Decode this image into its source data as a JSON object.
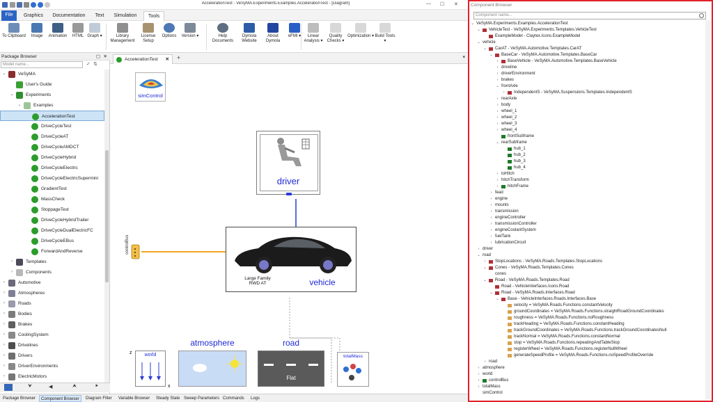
{
  "window": {
    "title": "AccelerationTest - VeSyMA.Experiments.Examples.AccelerationTest - [Diagram]"
  },
  "menu": {
    "tabs": [
      "File",
      "Graphics",
      "Documentation",
      "Text",
      "Simulation",
      "Tools"
    ],
    "active_tab": "Tools"
  },
  "ribbon": {
    "buttons": [
      "To Clipboard",
      "Image",
      "Animation",
      "HTML",
      "Graph ▾",
      "Library Management",
      "License Setup",
      "Options",
      "Version ▾",
      "Help Documents",
      "Dymola Website",
      "About Dymola",
      "eFMI ▾",
      "Linear Analysis ▾",
      "Quality Checks ▾",
      "Optimization ▾",
      "Build Tools ▾"
    ]
  },
  "package_browser": {
    "title": "Package Browser",
    "filter_placeholder": "Model name...",
    "items": [
      {
        "label": "VeSyMA",
        "indent": 0,
        "expand": "⌄",
        "icon": "#8b2d2d"
      },
      {
        "label": "User's Guide",
        "indent": 1,
        "expand": "",
        "icon": "#39a035"
      },
      {
        "label": "Experiments",
        "indent": 1,
        "expand": "⌄",
        "icon": "#2f8f2f"
      },
      {
        "label": "Examples",
        "indent": 2,
        "expand": "⌄",
        "icon": "#9cc69a"
      },
      {
        "label": "AccelerationTest",
        "indent": 3,
        "expand": "",
        "icon": "#2c9c2c",
        "selected": true
      },
      {
        "label": "DriveCycleTest",
        "indent": 3,
        "expand": "",
        "icon": "#2c9c2c"
      },
      {
        "label": "DriveCycleAT",
        "indent": 3,
        "expand": "",
        "icon": "#2c9c2c"
      },
      {
        "label": "DriveCycleAMDCT",
        "indent": 3,
        "expand": "",
        "icon": "#2c9c2c"
      },
      {
        "label": "DriveCycleHybrid",
        "indent": 3,
        "expand": "",
        "icon": "#2c9c2c"
      },
      {
        "label": "DriveCycleElectric",
        "indent": 3,
        "expand": "",
        "icon": "#2c9c2c"
      },
      {
        "label": "DriveCycleElectricSupermini",
        "indent": 3,
        "expand": "",
        "icon": "#2c9c2c"
      },
      {
        "label": "GradientTest",
        "indent": 3,
        "expand": "",
        "icon": "#2c9c2c"
      },
      {
        "label": "MassCheck",
        "indent": 3,
        "expand": "",
        "icon": "#2c9c2c"
      },
      {
        "label": "StoppageTest",
        "indent": 3,
        "expand": "",
        "icon": "#2c9c2c"
      },
      {
        "label": "DriveCycleHybridTrailer",
        "indent": 3,
        "expand": "",
        "icon": "#2c9c2c"
      },
      {
        "label": "DriveCycleDualElectricFC",
        "indent": 3,
        "expand": "",
        "icon": "#2c9c2c"
      },
      {
        "label": "DriveCycleEBus",
        "indent": 3,
        "expand": "",
        "icon": "#2c9c2c"
      },
      {
        "label": "ForwardAndReverse",
        "indent": 3,
        "expand": "",
        "icon": "#2c9c2c"
      },
      {
        "label": "Templates",
        "indent": 1,
        "expand": "›",
        "icon": "#4b4b5a"
      },
      {
        "label": "Components",
        "indent": 1,
        "expand": "›",
        "icon": "#b8b8b8"
      },
      {
        "label": "Automotive",
        "indent": 0,
        "expand": "›",
        "icon": "#6a6a7a"
      },
      {
        "label": "Atmospheres",
        "indent": 0,
        "expand": "›",
        "icon": "#7f7f95"
      },
      {
        "label": "Roads",
        "indent": 0,
        "expand": "›",
        "icon": "#9a9aae"
      },
      {
        "label": "Bodies",
        "indent": 0,
        "expand": "›",
        "icon": "#7b7b7b"
      },
      {
        "label": "Brakes",
        "indent": 0,
        "expand": "›",
        "icon": "#5f5f5f"
      },
      {
        "label": "CoolingSystem",
        "indent": 0,
        "expand": "›",
        "icon": "#8a8a8a"
      },
      {
        "label": "Drivelines",
        "indent": 0,
        "expand": "›",
        "icon": "#4f4f4f"
      },
      {
        "label": "Drivers",
        "indent": 0,
        "expand": "›",
        "icon": "#6f6f6f"
      },
      {
        "label": "DriverEnvironments",
        "indent": 0,
        "expand": "›",
        "icon": "#888"
      },
      {
        "label": "ElectricMotors",
        "indent": 0,
        "expand": "›",
        "icon": "#777"
      }
    ]
  },
  "diagram": {
    "tab_label": "AccelerationTest",
    "blocks": {
      "simControl": "simControl",
      "driver": "driver",
      "vehicle": "vehicle",
      "vehicle_sub": "Large Family\nRWD AT",
      "controlBus": "controlBus",
      "world": "world",
      "atmosphere": "atmosphere",
      "road": "road",
      "road_sub": "Flat",
      "totalMass": "totalMass"
    }
  },
  "bottom_tabs": {
    "tabs": [
      "Package Browser",
      "Component Browser",
      "Diagram Filter",
      "Variable Browser",
      "Steady State",
      "Sweep Parameters",
      "Commands",
      "Logs"
    ],
    "active": "Component Browser"
  },
  "component_browser": {
    "title": "Component Browser",
    "filter_placeholder": "Component name...",
    "rows": [
      {
        "t": "VeSyMA.Experiments.Examples.AccelerationTest",
        "i": 0,
        "e": "⌄",
        "c": "",
        "sel": true
      },
      {
        "t": "VehicleTest - VeSyMA.Experiments.Templates.VehicleTest",
        "i": 1,
        "e": "⌄",
        "c": "#b0303a"
      },
      {
        "t": "ExampleModel - Claytex.Icons.ExampleModel",
        "i": 2,
        "e": "",
        "c": "#b0303a"
      },
      {
        "t": "vehicle",
        "i": 1,
        "e": "⌄",
        "c": ""
      },
      {
        "t": "CarAT - VeSyMA.Automotive.Templates.CarAT",
        "i": 2,
        "e": "⌄",
        "c": "#b0303a"
      },
      {
        "t": "BaseCar - VeSyMA.Automotive.Templates.BaseCar",
        "i": 3,
        "e": "⌄",
        "c": "#b0303a"
      },
      {
        "t": "BaseVehicle - VeSyMA.Automotive.Templates.BaseVehicle",
        "i": 4,
        "e": "›",
        "c": "#b0303a"
      },
      {
        "t": "driveline",
        "i": 4,
        "e": "›",
        "c": ""
      },
      {
        "t": "driverEnvironment",
        "i": 4,
        "e": "›",
        "c": ""
      },
      {
        "t": "brakes",
        "i": 4,
        "e": "›",
        "c": ""
      },
      {
        "t": "frontAxle",
        "i": 4,
        "e": "⌄",
        "c": ""
      },
      {
        "t": "IndependentS - VeSyMA.Suspensions.Templates.IndependentS",
        "i": 5,
        "e": "›",
        "c": "#b0303a"
      },
      {
        "t": "rearAxle",
        "i": 4,
        "e": "›",
        "c": ""
      },
      {
        "t": "body",
        "i": 4,
        "e": "›",
        "c": ""
      },
      {
        "t": "wheel_1",
        "i": 4,
        "e": "›",
        "c": ""
      },
      {
        "t": "wheel_2",
        "i": 4,
        "e": "›",
        "c": ""
      },
      {
        "t": "wheel_3",
        "i": 4,
        "e": "›",
        "c": ""
      },
      {
        "t": "wheel_4",
        "i": 4,
        "e": "›",
        "c": ""
      },
      {
        "t": "frontSubframe",
        "i": 4,
        "e": "",
        "c": "#1f7a2a"
      },
      {
        "t": "rearSubframe",
        "i": 4,
        "e": "⌄",
        "c": ""
      },
      {
        "t": "hub_1",
        "i": 5,
        "e": "",
        "c": "#1f7a2a"
      },
      {
        "t": "hub_2",
        "i": 5,
        "e": "",
        "c": "#1f7a2a"
      },
      {
        "t": "hub_3",
        "i": 5,
        "e": "",
        "c": "#1f7a2a"
      },
      {
        "t": "hub_4",
        "i": 5,
        "e": "",
        "c": "#1f7a2a"
      },
      {
        "t": "toHitch",
        "i": 4,
        "e": "›",
        "c": ""
      },
      {
        "t": "hitchTransform",
        "i": 4,
        "e": "›",
        "c": ""
      },
      {
        "t": "hitchFrame",
        "i": 4,
        "e": "›",
        "c": "#1f7a2a"
      },
      {
        "t": "fead",
        "i": 3,
        "e": "›",
        "c": ""
      },
      {
        "t": "engine",
        "i": 3,
        "e": "›",
        "c": ""
      },
      {
        "t": "mounts",
        "i": 3,
        "e": "›",
        "c": ""
      },
      {
        "t": "transmission",
        "i": 3,
        "e": "›",
        "c": ""
      },
      {
        "t": "engineController",
        "i": 3,
        "e": "›",
        "c": ""
      },
      {
        "t": "transmissionController",
        "i": 3,
        "e": "›",
        "c": ""
      },
      {
        "t": "engineCoolantSystem",
        "i": 3,
        "e": "›",
        "c": ""
      },
      {
        "t": "fuelTank",
        "i": 3,
        "e": "›",
        "c": ""
      },
      {
        "t": "lubricationCircuit",
        "i": 3,
        "e": "›",
        "c": ""
      },
      {
        "t": "driver",
        "i": 1,
        "e": "›",
        "c": ""
      },
      {
        "t": "road",
        "i": 1,
        "e": "⌄",
        "c": ""
      },
      {
        "t": "StopLocations - VeSyMA.Roads.Templates.StopLocations",
        "i": 2,
        "e": "›",
        "c": "#b0303a"
      },
      {
        "t": "Cones - VeSyMA.Roads.Templates.Cones",
        "i": 2,
        "e": "⌄",
        "c": "#b0303a"
      },
      {
        "t": "cones",
        "i": 3,
        "e": "",
        "c": ""
      },
      {
        "t": "Road - VeSyMA.Roads.Templates.Road",
        "i": 2,
        "e": "⌄",
        "c": "#b0303a"
      },
      {
        "t": "Road - VehicleInterfaces.Icons.Road",
        "i": 3,
        "e": "",
        "c": "#b0303a"
      },
      {
        "t": "Road - VeSyMA.Roads.Interfaces.Road",
        "i": 3,
        "e": "⌄",
        "c": "#b0303a"
      },
      {
        "t": "Base - VehicleInterfaces.Roads.Interfaces.Base",
        "i": 4,
        "e": "⌄",
        "c": "#b0303a"
      },
      {
        "t": "velocity = VeSyMA.Roads.Functions.constantVelocity",
        "i": 5,
        "e": "",
        "c": "#d9a24b"
      },
      {
        "t": "groundCoordinates = VeSyMA.Roads.Functions.straightRoadGroundCoordinates",
        "i": 5,
        "e": "",
        "c": "#d9a24b"
      },
      {
        "t": "roughness = VeSyMA.Roads.Functions.noRoughness",
        "i": 5,
        "e": "",
        "c": "#d9a24b"
      },
      {
        "t": "trackHeading = VeSyMA.Roads.Functions.constantHeading",
        "i": 5,
        "e": "",
        "c": "#d9a24b"
      },
      {
        "t": "trackGroundCoordinates = VeSyMA.Roads.Functions.trackGroundCoordinatesNull",
        "i": 5,
        "e": "",
        "c": "#d9a24b"
      },
      {
        "t": "trackNormal = VeSyMA.Roads.Functions.constantNormal",
        "i": 5,
        "e": "",
        "c": "#d9a24b"
      },
      {
        "t": "stop = VeSyMA.Roads.Functions.repeatingAndTableStop",
        "i": 5,
        "e": "",
        "c": "#d9a24b"
      },
      {
        "t": "registerWheel = VeSyMA.Roads.Functions.registerNullWheel",
        "i": 5,
        "e": "",
        "c": "#d9a24b"
      },
      {
        "t": "generateSpeedProfile = VeSyMA.Roads.Functions.noSpeedProfileOverride",
        "i": 5,
        "e": "",
        "c": "#d9a24b"
      },
      {
        "t": "road",
        "i": 2,
        "e": "›",
        "c": ""
      },
      {
        "t": "atmosphere",
        "i": 1,
        "e": "›",
        "c": ""
      },
      {
        "t": "world",
        "i": 1,
        "e": "›",
        "c": ""
      },
      {
        "t": "controlBus",
        "i": 1,
        "e": "›",
        "c": "#1f7a2a"
      },
      {
        "t": "totalMass",
        "i": 1,
        "e": "›",
        "c": ""
      },
      {
        "t": "simControl",
        "i": 1,
        "e": "",
        "c": ""
      }
    ]
  }
}
